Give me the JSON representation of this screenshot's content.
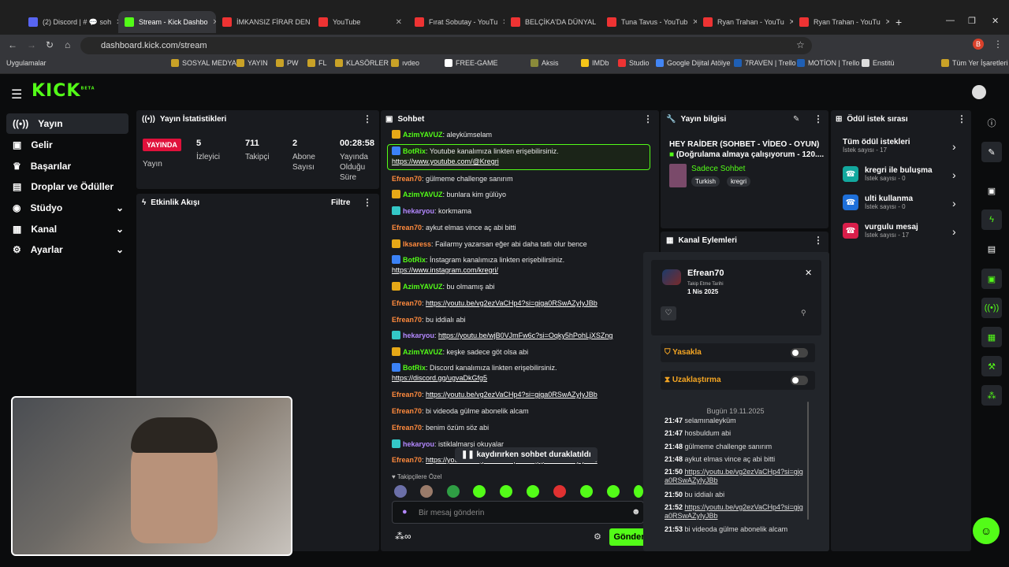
{
  "browser": {
    "tabs": [
      {
        "label": "(2) Discord | # 💬 soh"
      },
      {
        "label": "Stream - Kick Dashbo"
      },
      {
        "label": "İMKANSIZ FİRAR DEN"
      },
      {
        "label": "YouTube"
      },
      {
        "label": "Fırat Sobutay - YouTu"
      },
      {
        "label": "BELÇİKA'DA DÜNYAL"
      },
      {
        "label": "Tuna Tavus - YouTub"
      },
      {
        "label": "Ryan Trahan - YouTu"
      },
      {
        "label": "Ryan Trahan - YouTu"
      }
    ],
    "url": "dashboard.kick.com/stream",
    "bookmarks": [
      "Uygulamalar",
      "SOSYAL MEDYA",
      "YAYIN",
      "PW",
      "FL",
      "KLASÖRLER",
      "ıvdeo",
      "FREE-GAME",
      "Aksis",
      "IMDb",
      "Studio",
      "Google Dijital Atölye",
      "7RAVEN | Trello",
      "MOTİON | Trello",
      "Enstitü",
      "Tüm Yer İşaretleri"
    ]
  },
  "app": {
    "logo": "KICK",
    "logo_sup": "BETA"
  },
  "sidebar": {
    "items": [
      {
        "label": "Yayın",
        "icon": "broadcast-icon"
      },
      {
        "label": "Gelir",
        "icon": "wallet-icon"
      },
      {
        "label": "Başarılar",
        "icon": "trophy-icon"
      },
      {
        "label": "Droplar ve Ödüller",
        "icon": "gift-icon"
      },
      {
        "label": "Stüdyo",
        "icon": "studio-icon"
      },
      {
        "label": "Kanal",
        "icon": "channel-icon"
      },
      {
        "label": "Ayarlar",
        "icon": "gear-icon"
      }
    ]
  },
  "stats": {
    "title": "Yayın İstatistikleri",
    "live_badge": "YAYINDA",
    "live_label": "Yayın",
    "viewers": {
      "value": "5",
      "label": "İzleyici"
    },
    "followers": {
      "value": "711",
      "label": "Takipçi"
    },
    "subs": {
      "value": "2",
      "label": "Abone Sayısı"
    },
    "duration": {
      "value": "00:28:58",
      "label": "Yayında Olduğu Süre"
    }
  },
  "activity": {
    "title": "Etkinlik Akışı",
    "filter": "Filtre"
  },
  "chat": {
    "title": "Sohbet",
    "messages": [
      {
        "user": "AzimYAVUZ",
        "color": "#53fc18",
        "text": ": aleykümselam",
        "link": ""
      },
      {
        "user": "BotRix",
        "color": "#53fc18",
        "text": ": Youtube kanalımıza linkten erişebilirsiniz.",
        "link": "https://www.youtube.com/@Kregri"
      },
      {
        "user": "Efrean70",
        "color": "#ff8a3d",
        "text": ": gülmeme challenge sanırım",
        "link": ""
      },
      {
        "user": "AzimYAVUZ",
        "color": "#53fc18",
        "text": ": bunlara kim gülüyo",
        "link": ""
      },
      {
        "user": "hekaryou",
        "color": "#b388ff",
        "text": ": korkmama",
        "link": ""
      },
      {
        "user": "Efrean70",
        "color": "#ff8a3d",
        "text": ": aykut elmas vince aç abi bitti",
        "link": ""
      },
      {
        "user": "Iksaress",
        "color": "#ff8a3d",
        "text": ": Failarmy yazarsan eğer abi daha tatlı olur bence",
        "link": ""
      },
      {
        "user": "BotRix",
        "color": "#53fc18",
        "text": ": İnstagram kanalımıza linkten erişebilirsiniz.",
        "link": "https://www.instagram.com/kregri/"
      },
      {
        "user": "AzimYAVUZ",
        "color": "#53fc18",
        "text": ": bu olmamış abi",
        "link": ""
      },
      {
        "user": "Efrean70",
        "color": "#ff8a3d",
        "text": ": ",
        "link": "https://youtu.be/vg2ezVaCHp4?si=giga0RSwAZyIyJBb"
      },
      {
        "user": "Efrean70",
        "color": "#ff8a3d",
        "text": ": bu iddialı abi",
        "link": ""
      },
      {
        "user": "hekaryou",
        "color": "#b388ff",
        "text": ": ",
        "link": "https://youtu.be/wjB0VJmFw6c?si=Oqky5hPohLjXSZng"
      },
      {
        "user": "AzimYAVUZ",
        "color": "#53fc18",
        "text": ": keşke sadece göt olsa abi",
        "link": ""
      },
      {
        "user": "BotRix",
        "color": "#53fc18",
        "text": ": Discord kanalımıza linkten erişebilirsiniz.",
        "link": "https://discord.gg/ugvaDkGfg5"
      },
      {
        "user": "Efrean70",
        "color": "#ff8a3d",
        "text": ": ",
        "link": "https://youtu.be/vg2ezVaCHp4?si=giga0RSwAZyIyJBb"
      },
      {
        "user": "Efrean70",
        "color": "#ff8a3d",
        "text": ": bi videoda gülme abonelik alcam",
        "link": ""
      },
      {
        "user": "Efrean70",
        "color": "#ff8a3d",
        "text": ": benim özüm söz abi",
        "link": ""
      },
      {
        "user": "hekaryou",
        "color": "#b388ff",
        "text": ": istiklalmarşi okuyalar",
        "link": ""
      },
      {
        "user": "Efrean70",
        "color": "#ff8a3d",
        "text": ": ",
        "link": "https://youtu.be/vg2ezVaCHp4?si=giga0RSwAZyIyJBb"
      }
    ],
    "paused_notice": "kaydırırken sohbet duraklatıldı",
    "followers_only": "Takipçilere Özel",
    "input_placeholder": "Bir mesaj gönderin",
    "send": "Gönder",
    "infinity": "∞"
  },
  "stream_info": {
    "title": "Yayın bilgisi",
    "stream_title": "HEY RAİDER (SOHBET - VİDEO - OYUN)",
    "stream_title2": "(Doğrulama almaya çalışıyorum - 120....",
    "category": "Sadece Sohbet",
    "tags": [
      "Turkish",
      "kregri"
    ]
  },
  "channel_actions": {
    "title": "Kanal Eylemleri"
  },
  "user_card": {
    "name": "Efrean70",
    "follow_label": "Takip Etme Tarihi",
    "follow_date": "1 Nis 2025",
    "ban": "Yasakla",
    "timeout": "Uzaklaştırma",
    "date_header": "Bugün 19.11.2025",
    "history": [
      {
        "time": "21:47",
        "text": "selamınaleyküm",
        "link": false
      },
      {
        "time": "21:47",
        "text": "hosbuldum abi",
        "link": false
      },
      {
        "time": "21:48",
        "text": "gülmeme challenge sanırım",
        "link": false
      },
      {
        "time": "21:48",
        "text": "aykut elmas vince aç abi bitti",
        "link": false
      },
      {
        "time": "21:50",
        "text": "https://youtu.be/vg2ezVaCHp4?si=giga0RSwAZyIyJBb",
        "link": true
      },
      {
        "time": "21:50",
        "text": "bu iddialı abi",
        "link": false
      },
      {
        "time": "21:52",
        "text": "https://youtu.be/vg2ezVaCHp4?si=giga0RSwAZyIyJBb",
        "link": true
      },
      {
        "time": "21:53",
        "text": "bi videoda gülme abonelik alcam",
        "link": false
      }
    ]
  },
  "rewards": {
    "title": "Ödül istek sırası",
    "all": {
      "label": "Tüm ödül istekleri",
      "sub": "İstek sayısı - 17"
    },
    "items": [
      {
        "label": "kregri ile buluşma",
        "sub": "İstek sayısı - 0",
        "color": "#13a89e"
      },
      {
        "label": "ulti kullanma",
        "sub": "İstek sayısı - 0",
        "color": "#1e6fd9"
      },
      {
        "label": "vurgulu mesaj",
        "sub": "İstek sayısı - 17",
        "color": "#d91e4a"
      }
    ]
  },
  "colors": {
    "accent": "#53fc18",
    "panel": "#191b1f",
    "live": "#e0113b"
  }
}
